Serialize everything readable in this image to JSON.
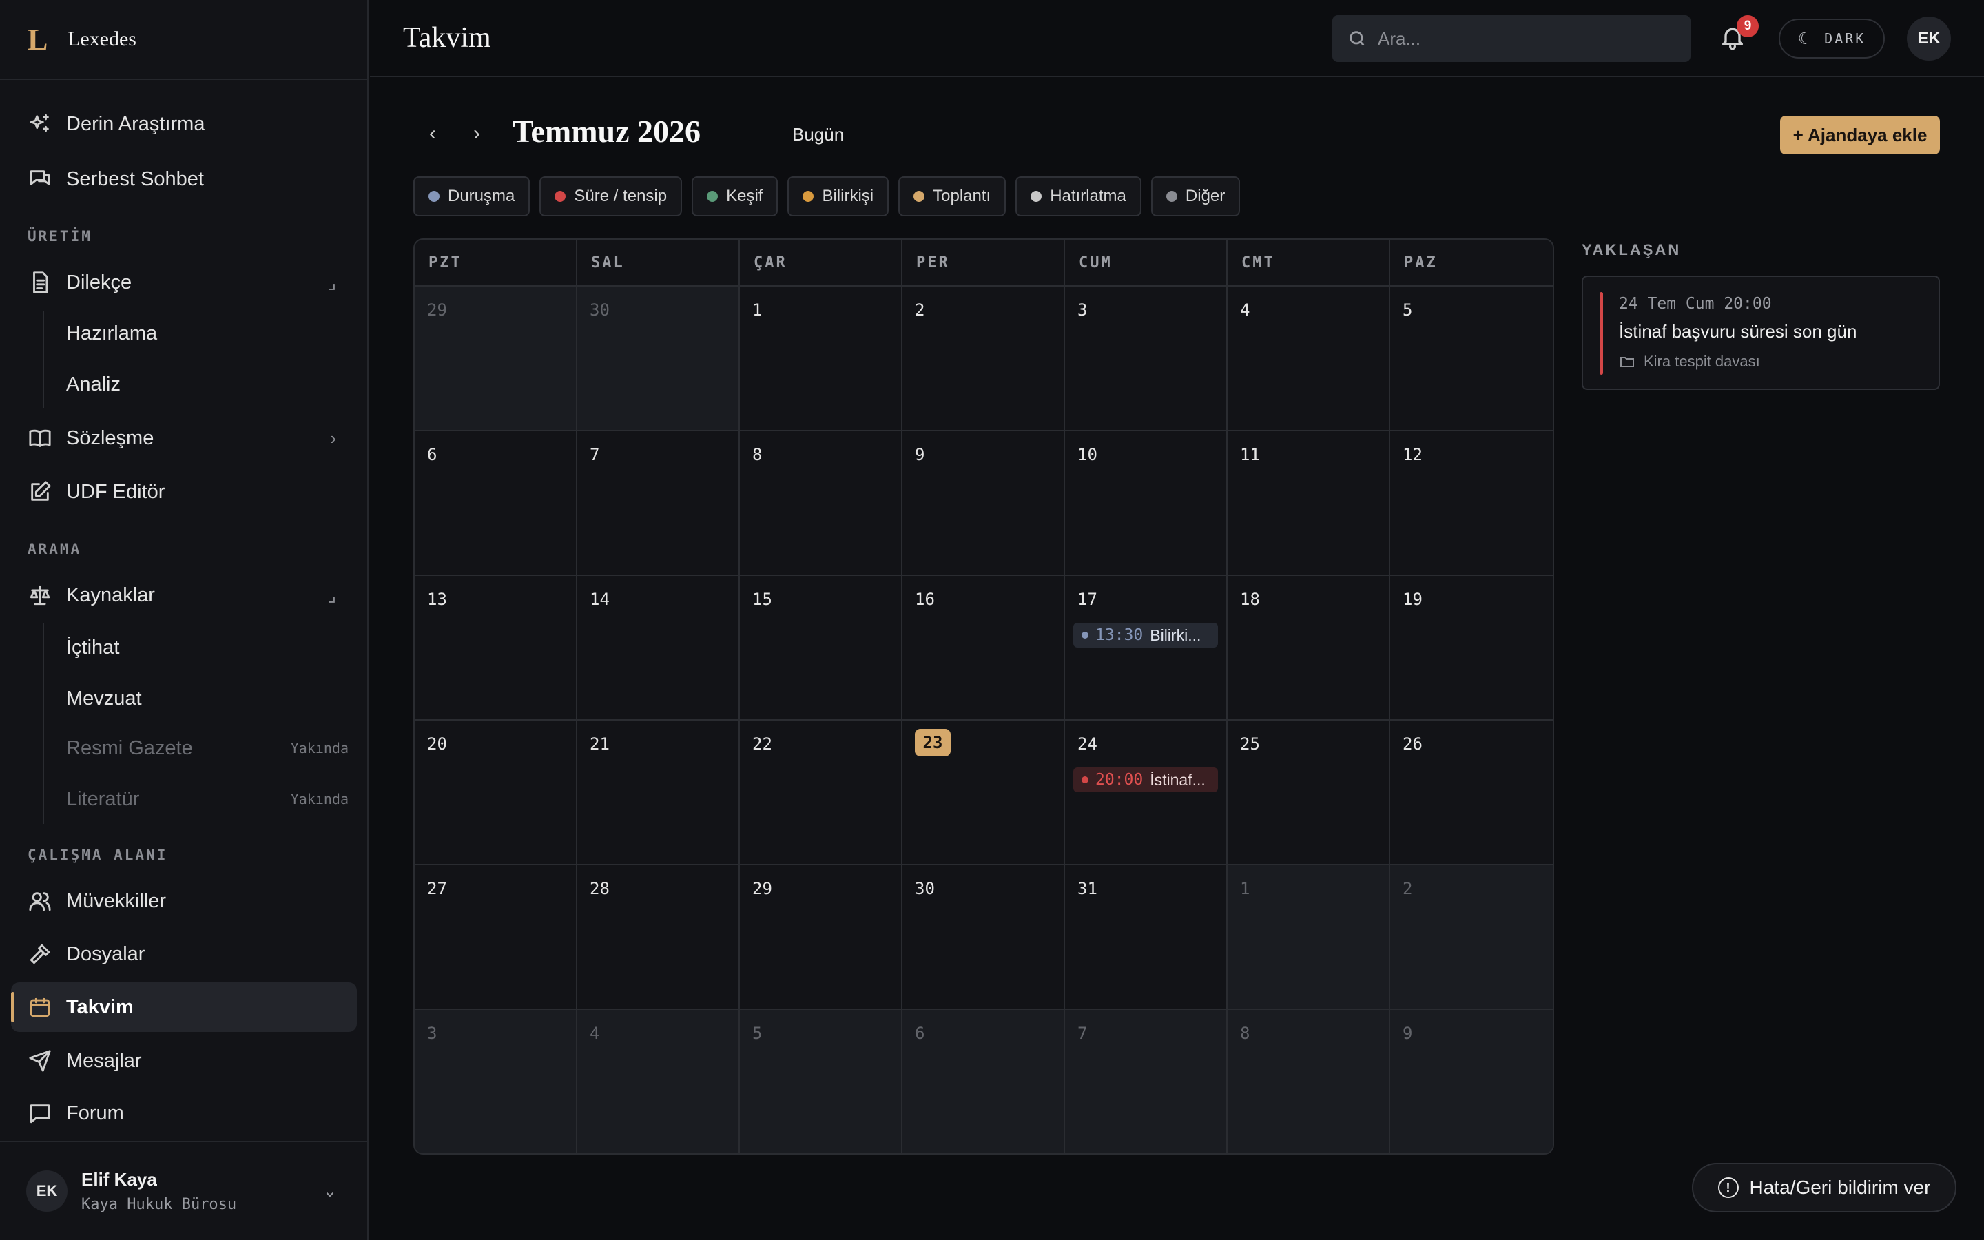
{
  "brand": {
    "logo": "L",
    "name": "Lexedes"
  },
  "sidebar": {
    "items": [
      {
        "label": "Derin Araştırma",
        "icon": "sparkles-icon"
      },
      {
        "label": "Serbest Sohbet",
        "icon": "chat-icon"
      }
    ],
    "sections": [
      {
        "label": "ÜRETİM",
        "items": [
          {
            "label": "Dilekçe",
            "icon": "document-icon",
            "children": [
              {
                "label": "Hazırlama"
              },
              {
                "label": "Analiz"
              }
            ]
          },
          {
            "label": "Sözleşme",
            "icon": "book-icon"
          },
          {
            "label": "UDF Editör",
            "icon": "edit-icon"
          }
        ]
      },
      {
        "label": "ARAMA",
        "items": [
          {
            "label": "Kaynaklar",
            "icon": "scale-icon",
            "children": [
              {
                "label": "İçtihat"
              },
              {
                "label": "Mevzuat"
              },
              {
                "label": "Resmi Gazete",
                "badge": "Yakında"
              },
              {
                "label": "Literatür",
                "badge": "Yakında"
              }
            ]
          }
        ]
      },
      {
        "label": "ÇALIŞMA ALANI",
        "items": [
          {
            "label": "Müvekkiller",
            "icon": "users-icon"
          },
          {
            "label": "Dosyalar",
            "icon": "gavel-icon"
          },
          {
            "label": "Takvim",
            "icon": "calendar-icon",
            "active": true
          },
          {
            "label": "Mesajlar",
            "icon": "send-icon"
          },
          {
            "label": "Forum",
            "icon": "message-square-icon"
          }
        ]
      }
    ],
    "user": {
      "initials": "EK",
      "name": "Elif Kaya",
      "org": "Kaya Hukuk Bürosu"
    }
  },
  "header": {
    "title": "Takvim",
    "search_placeholder": "Ara...",
    "notification_count": "9",
    "theme_label": "DARK",
    "avatar_initials": "EK"
  },
  "calendar": {
    "month_title": "Temmuz 2026",
    "today_label": "Bugün",
    "add_label": "+ Ajandaya ekle",
    "legend": [
      {
        "label": "Duruşma",
        "color": "#8596b8"
      },
      {
        "label": "Süre / tensip",
        "color": "#d34747"
      },
      {
        "label": "Keşif",
        "color": "#5a9a78"
      },
      {
        "label": "Bilirkişi",
        "color": "#d99a3e"
      },
      {
        "label": "Toplantı",
        "color": "#d5a86b"
      },
      {
        "label": "Hatırlatma",
        "color": "#c8c8c8"
      },
      {
        "label": "Diğer",
        "color": "#8a8c92"
      }
    ],
    "weekdays": [
      "PZT",
      "SAL",
      "ÇAR",
      "PER",
      "CUM",
      "CMT",
      "PAZ"
    ],
    "days": [
      {
        "d": "29",
        "outside": true
      },
      {
        "d": "30",
        "outside": true
      },
      {
        "d": "1"
      },
      {
        "d": "2"
      },
      {
        "d": "3"
      },
      {
        "d": "4"
      },
      {
        "d": "5"
      },
      {
        "d": "6"
      },
      {
        "d": "7"
      },
      {
        "d": "8"
      },
      {
        "d": "9"
      },
      {
        "d": "10"
      },
      {
        "d": "11"
      },
      {
        "d": "12"
      },
      {
        "d": "13"
      },
      {
        "d": "14"
      },
      {
        "d": "15"
      },
      {
        "d": "16"
      },
      {
        "d": "17",
        "event": {
          "time": "13:30",
          "title": "Bilirki...",
          "kind": "blue"
        }
      },
      {
        "d": "18"
      },
      {
        "d": "19"
      },
      {
        "d": "20"
      },
      {
        "d": "21"
      },
      {
        "d": "22"
      },
      {
        "d": "23",
        "today": true
      },
      {
        "d": "24",
        "event": {
          "time": "20:00",
          "title": "İstinaf...",
          "kind": "red"
        }
      },
      {
        "d": "25"
      },
      {
        "d": "26"
      },
      {
        "d": "27"
      },
      {
        "d": "28"
      },
      {
        "d": "29"
      },
      {
        "d": "30"
      },
      {
        "d": "31"
      },
      {
        "d": "1",
        "outside": true
      },
      {
        "d": "2",
        "outside": true
      },
      {
        "d": "3",
        "outside": true
      },
      {
        "d": "4",
        "outside": true
      },
      {
        "d": "5",
        "outside": true
      },
      {
        "d": "6",
        "outside": true
      },
      {
        "d": "7",
        "outside": true
      },
      {
        "d": "8",
        "outside": true
      },
      {
        "d": "9",
        "outside": true
      }
    ]
  },
  "upcoming": {
    "label": "YAKLAŞAN",
    "items": [
      {
        "time": "24 Tem Cum 20:00",
        "title": "İstinaf başvuru süresi son gün",
        "case": "Kira tespit davası",
        "color": "#d34747"
      }
    ]
  },
  "feedback_label": "Hata/Geri bildirim ver"
}
